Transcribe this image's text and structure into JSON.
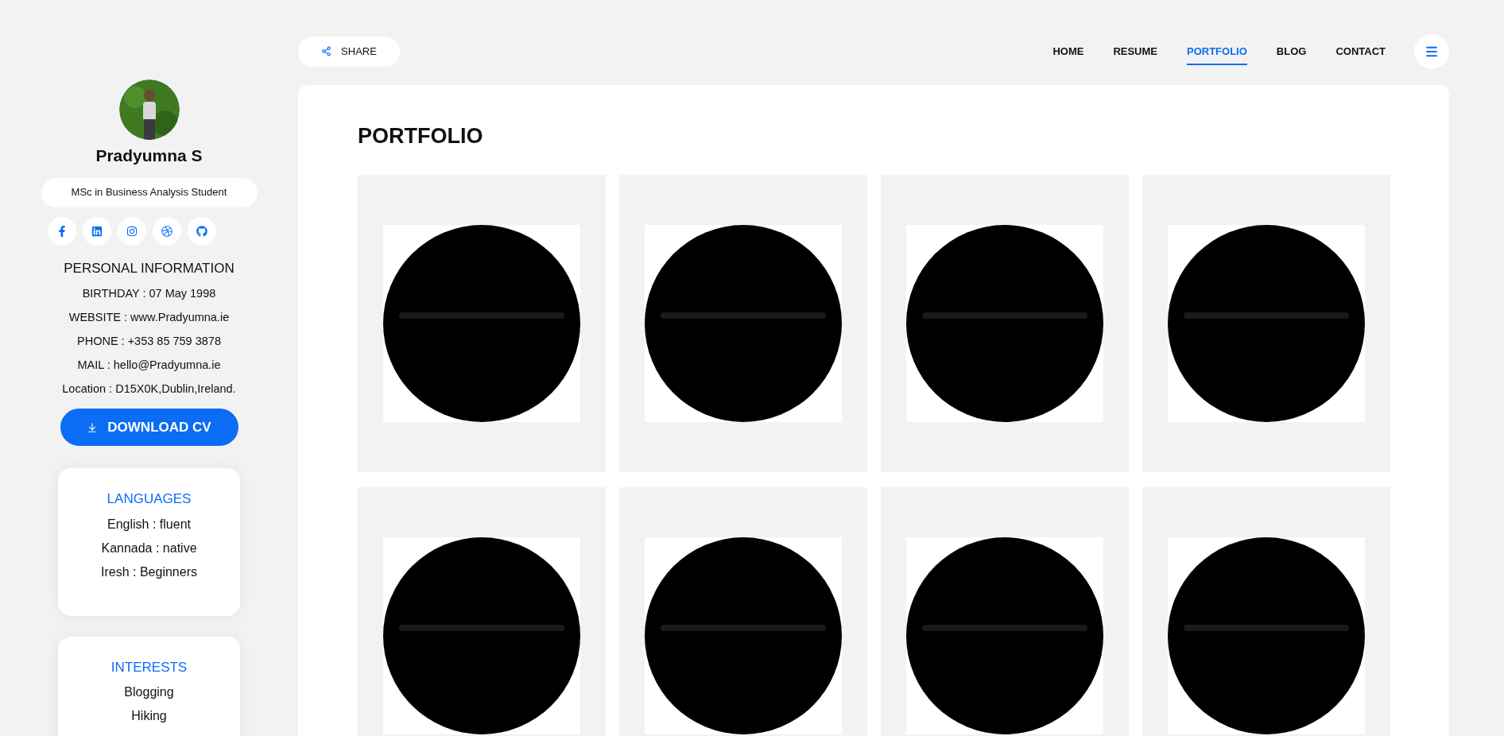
{
  "share": {
    "label": "SHARE"
  },
  "nav": [
    {
      "label": "HOME",
      "selected": false
    },
    {
      "label": "RESUME",
      "selected": false
    },
    {
      "label": "PORTFOLIO",
      "selected": true
    },
    {
      "label": "BLOG",
      "selected": false
    },
    {
      "label": "CONTACT",
      "selected": false
    }
  ],
  "profile": {
    "name": "Pradyumna S",
    "title": "MSc in Business Analysis Student"
  },
  "personal_information": {
    "heading": "PERSONAL INFORMATION",
    "items": [
      "BIRTHDAY : 07 May 1998",
      "WEBSITE : www.Pradyumna.ie",
      "PHONE : +353 85 759 3878",
      "MAIL : hello@Pradyumna.ie",
      "Location : D15X0K,Dublin,Ireland."
    ]
  },
  "download_button": {
    "label": "DOWNLOAD CV"
  },
  "languages": {
    "heading": "LANGUAGES",
    "items": [
      "English : fluent",
      "Kannada : native",
      "Iresh : Beginners"
    ]
  },
  "interests": {
    "heading": "INTERESTS",
    "items": [
      "Blogging",
      "Hiking"
    ]
  },
  "portfolio": {
    "heading": "PORTFOLIO"
  }
}
